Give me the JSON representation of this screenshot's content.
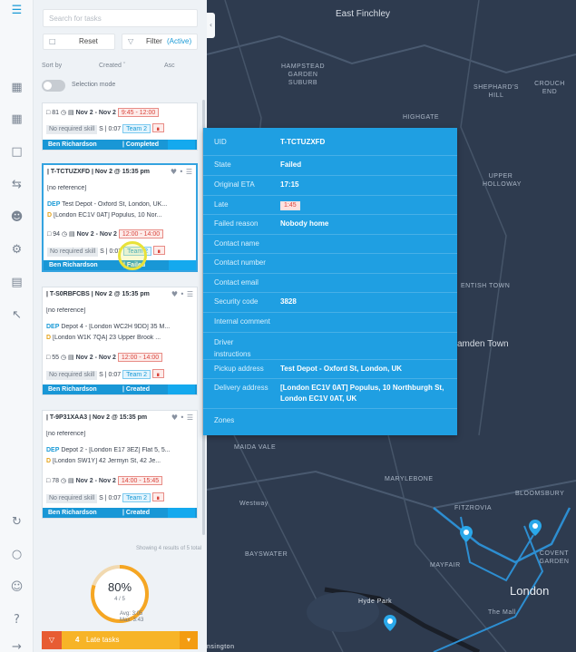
{
  "sidebar_icons": [
    "tasks-icon",
    "map-icon",
    "calendar-icon",
    "box-icon",
    "routes-icon",
    "users-icon",
    "settings-icon",
    "store-icon",
    "chart-icon",
    "sync-icon",
    "hierarchy-icon",
    "team-icon",
    "help-icon",
    "logout-icon"
  ],
  "panel": {
    "search_placeholder": "Search for tasks",
    "reset_label": "Reset",
    "filter_label": "Filter",
    "filter_state": "(Active)",
    "sort_by_label": "Sort by",
    "sort_value": "Created",
    "sort_dir": "Asc",
    "selection_mode_label": "Selection mode",
    "showing_text": "Showing 4 results of 5 total"
  },
  "tasks": [
    {
      "header_left": "81",
      "dates": "Nov 2 - Nov 2",
      "time": "9:45 - 12:00",
      "skill": "No required skill",
      "s": "S | 0:07",
      "team": "Team 2",
      "driver": "Ben Richardson",
      "status": "| Completed"
    },
    {
      "id_line": "| T-TCTUZXFD | Nov 2 @ 15:35 pm",
      "ref": "[no reference]",
      "dep_tag": "DEP",
      "dep": "Test Depot - Oxford St, London, UK...",
      "d_tag": "D",
      "dest": "[London EC1V 0AT] Populus, 10 Nor...",
      "count": "94",
      "dates": "Nov 2 - Nov 2",
      "time": "12:00 - 14:00",
      "skill": "No required skill",
      "s": "S | 0:07",
      "team": "Team 2",
      "driver": "Ben Richardson",
      "status": "| Failed"
    },
    {
      "id_line": "| T-S0RBFCBS | Nov 2 @ 15:35 pm",
      "ref": "[no reference]",
      "dep_tag": "DEP",
      "dep": "Depot 4 - [London WC2H 9DD] 35 M...",
      "d_tag": "D",
      "dest": "[London W1K 7QA] 23 Upper Brook ...",
      "count": "55",
      "dates": "Nov 2 - Nov 2",
      "time": "12:00 - 14:00",
      "skill": "No required skill",
      "s": "S | 0:07",
      "team": "Team 2",
      "driver": "Ben Richardson",
      "status": "| Created"
    },
    {
      "id_line": "| T-9P31XAA3 | Nov 2 @ 15:35 pm",
      "ref": "[no reference]",
      "dep_tag": "DEP",
      "dep": "Depot 2 - [London E17 3EZ] Flat 5, 5...",
      "d_tag": "D",
      "dest": "[London SW1Y] 42 Jermyn St, 42 Je...",
      "count": "78",
      "dates": "Nov 2 - Nov 2",
      "time": "14:00 - 15:45",
      "skill": "No required skill",
      "s": "S | 0:07",
      "team": "Team 2",
      "driver": "Ben Richardson",
      "status": "| Created"
    }
  ],
  "gauge": {
    "percent_label": "80%",
    "percent": 0.8,
    "count": "4 / 5",
    "avg": "Avg: 3:05",
    "max": "Max: 3:43"
  },
  "late_tasks": {
    "count": "4",
    "label": "Late tasks"
  },
  "popup": {
    "rows": [
      {
        "k": "UID",
        "v": "T-TCTUZXFD"
      },
      {
        "k": "State",
        "v": "Failed"
      },
      {
        "k": "Original ETA",
        "v": "17:15"
      },
      {
        "k": "Late",
        "v": "1:45"
      },
      {
        "k": "Failed reason",
        "v": "Nobody home"
      },
      {
        "k": "Contact name",
        "v": ""
      },
      {
        "k": "Contact number",
        "v": ""
      },
      {
        "k": "Contact email",
        "v": ""
      },
      {
        "k": "Security code",
        "v": "3828"
      },
      {
        "k": "Internal comment",
        "v": ""
      },
      {
        "k": "Driver instructions",
        "v": ""
      },
      {
        "k": "Pickup address",
        "v": "Test Depot - Oxford St, London, UK"
      },
      {
        "k": "Delivery address",
        "v": "[London EC1V 0AT] Populus, 10 Northburgh St, London EC1V 0AT, UK"
      },
      {
        "k": "Zones",
        "v": ""
      }
    ]
  },
  "map_labels": [
    {
      "t": "East Finchley"
    },
    {
      "t": "HAMPSTEAD GARDEN SUBURB"
    },
    {
      "t": "SHEPHARD'S HILL"
    },
    {
      "t": "CROUCH END"
    },
    {
      "t": "HIGHGATE"
    },
    {
      "t": "UPPER HOLLOWAY"
    },
    {
      "t": "ENTISH TOWN"
    },
    {
      "t": "amden Town"
    },
    {
      "t": "MAIDA VALE"
    },
    {
      "t": "MARYLEBONE"
    },
    {
      "t": "BLOOMSBURY"
    },
    {
      "t": "BAYSWATER"
    },
    {
      "t": "MAYFAIR"
    },
    {
      "t": "Hyde Park"
    },
    {
      "t": "COVENT GARDEN"
    },
    {
      "t": "London"
    },
    {
      "t": "FITZROVIA"
    },
    {
      "t": "The Mall"
    },
    {
      "t": "Westway"
    },
    {
      "t": "nsington"
    }
  ]
}
